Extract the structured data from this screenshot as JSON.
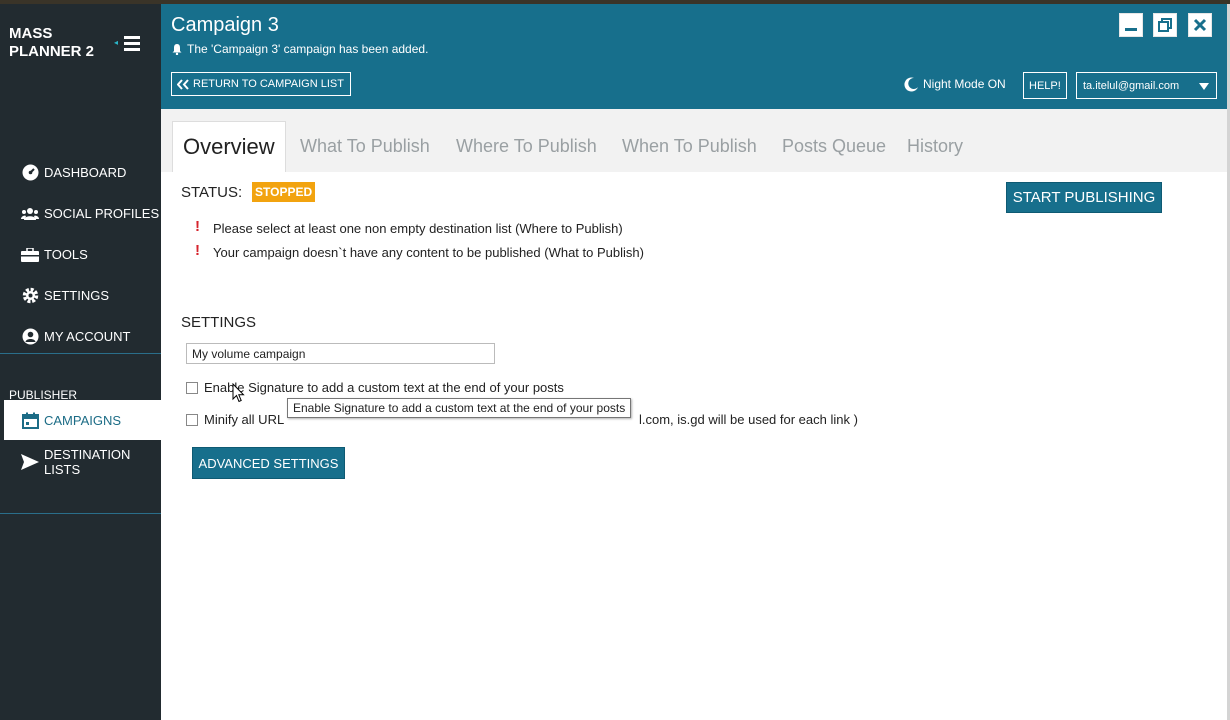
{
  "app": {
    "logo_line1": "MASS",
    "logo_line2": "PLANNER 2"
  },
  "sidebar": {
    "items": [
      {
        "label": "DASHBOARD",
        "icon": "dashboard-icon"
      },
      {
        "label": "SOCIAL PROFILES",
        "icon": "users-icon"
      },
      {
        "label": "TOOLS",
        "icon": "toolbox-icon"
      },
      {
        "label": "SETTINGS",
        "icon": "gear-icon"
      },
      {
        "label": "MY ACCOUNT",
        "icon": "user-circle-icon"
      }
    ],
    "section_label": "PUBLISHER",
    "campaigns_label": "CAMPAIGNS",
    "destination_label": "DESTINATION LISTS"
  },
  "header": {
    "title": "Campaign 3",
    "notice": "The 'Campaign 3' campaign has been added.",
    "return_label": "RETURN TO CAMPAIGN LIST",
    "night_mode": "Night Mode ON",
    "help": "HELP!",
    "account": "ta.itelul@gmail.com"
  },
  "tabs": [
    "Overview",
    "What To Publish",
    "Where To Publish",
    "When To Publish",
    "Posts Queue",
    "History"
  ],
  "status": {
    "label": "STATUS:",
    "value": "STOPPED",
    "start_button": "START PUBLISHING",
    "warnings": [
      "Please select at least one non empty destination list (Where to Publish)",
      "Your campaign doesn`t have any content to be published (What to Publish)"
    ]
  },
  "settings": {
    "label": "SETTINGS",
    "campaign_name": "My volume campaign",
    "signature_label": "Enable Signature to add a custom text at the end of your posts",
    "signature_tooltip": "Enable Signature to add a custom text at the end of your posts",
    "minify_start": "Minify all URL",
    "minify_end": "l.com, is.gd will be used for each link )",
    "advanced_button": "ADVANCED SETTINGS"
  },
  "colors": {
    "header": "#176f8c",
    "sidebar": "#222b30",
    "badge": "#f2a30f",
    "warning": "#d6242d"
  }
}
